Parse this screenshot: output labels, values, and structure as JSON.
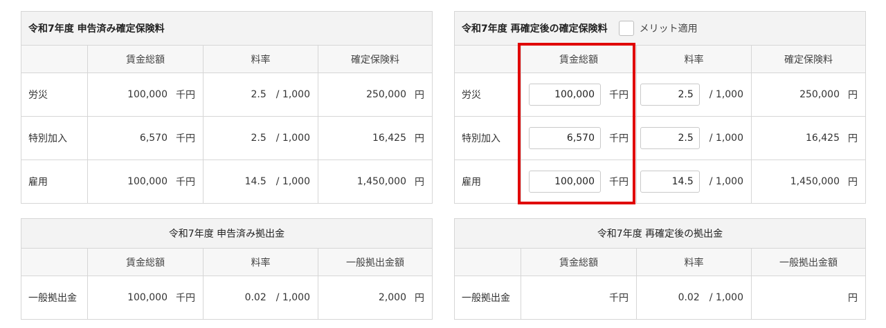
{
  "declared_premium": {
    "title": "令和7年度 申告済み確定保険料",
    "headers": [
      "賃金総額",
      "料率",
      "確定保険料"
    ],
    "rows": [
      {
        "label": "労災",
        "wage": "100,000",
        "wage_unit": "千円",
        "rate": "2.5",
        "rate_unit": "/ 1,000",
        "premium": "250,000",
        "premium_unit": "円"
      },
      {
        "label": "特別加入",
        "wage": "6,570",
        "wage_unit": "千円",
        "rate": "2.5",
        "rate_unit": "/ 1,000",
        "premium": "16,425",
        "premium_unit": "円"
      },
      {
        "label": "雇用",
        "wage": "100,000",
        "wage_unit": "千円",
        "rate": "14.5",
        "rate_unit": "/ 1,000",
        "premium": "1,450,000",
        "premium_unit": "円"
      }
    ]
  },
  "reconfirmed_premium": {
    "title": "令和7年度 再確定後の確定保険料",
    "merit_label": "メリット適用",
    "merit_checked": false,
    "headers": [
      "賃金総額",
      "料率",
      "確定保険料"
    ],
    "rows": [
      {
        "label": "労災",
        "wage": "100,000",
        "wage_unit": "千円",
        "rate": "2.5",
        "rate_unit": "/ 1,000",
        "premium": "250,000",
        "premium_unit": "円"
      },
      {
        "label": "特別加入",
        "wage": "6,570",
        "wage_unit": "千円",
        "rate": "2.5",
        "rate_unit": "/ 1,000",
        "premium": "16,425",
        "premium_unit": "円"
      },
      {
        "label": "雇用",
        "wage": "100,000",
        "wage_unit": "千円",
        "rate": "14.5",
        "rate_unit": "/ 1,000",
        "premium": "1,450,000",
        "premium_unit": "円"
      }
    ]
  },
  "declared_contribution": {
    "title": "令和7年度 申告済み拠出金",
    "headers": [
      "賃金総額",
      "料率",
      "一般拠出金額"
    ],
    "row": {
      "label": "一般拠出金",
      "wage": "100,000",
      "wage_unit": "千円",
      "rate": "0.02",
      "rate_unit": "/ 1,000",
      "amount": "2,000",
      "amount_unit": "円"
    }
  },
  "reconfirmed_contribution": {
    "title": "令和7年度 再確定後の拠出金",
    "headers": [
      "賃金総額",
      "料率",
      "一般拠出金額"
    ],
    "row": {
      "label": "一般拠出金",
      "wage": "",
      "wage_unit": "千円",
      "rate": "0.02",
      "rate_unit": "/ 1,000",
      "amount": "",
      "amount_unit": "円"
    }
  },
  "colors": {
    "highlight": "#e00000",
    "header_bg": "#f3f3f3",
    "border": "#d6d6d6"
  }
}
